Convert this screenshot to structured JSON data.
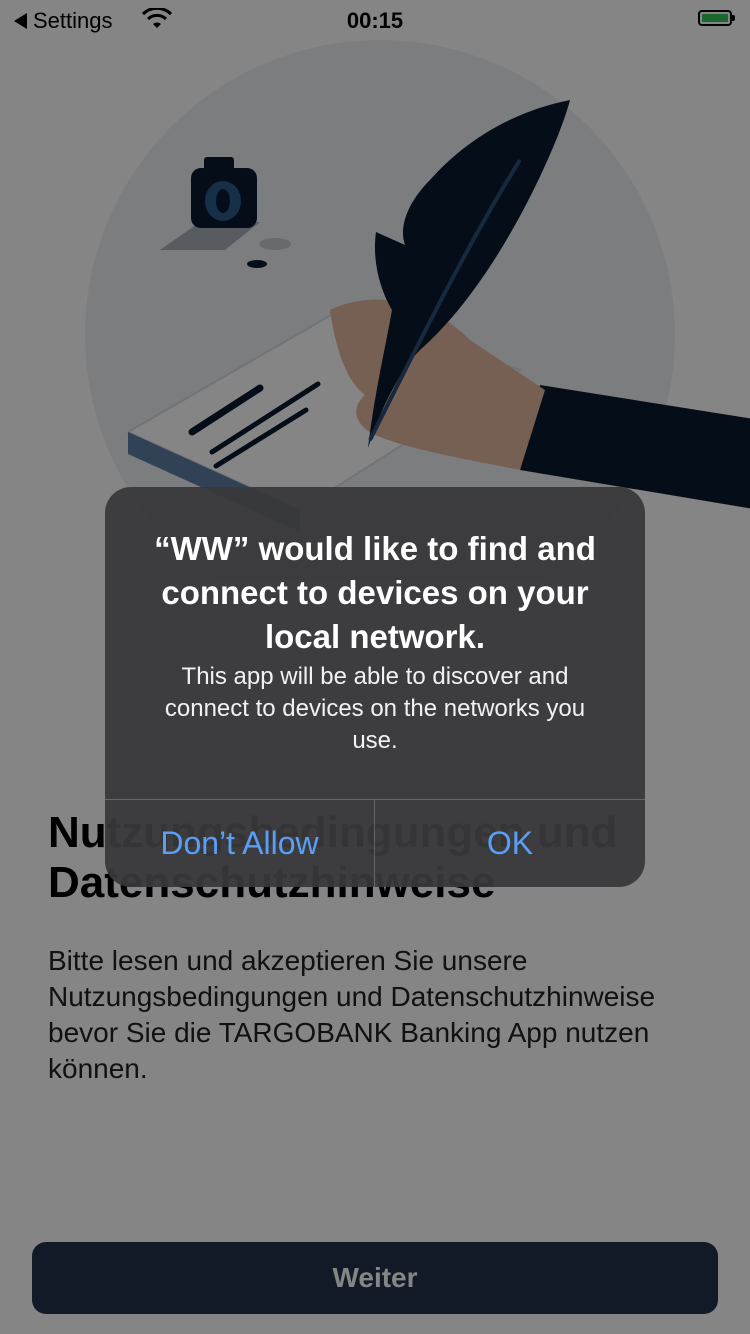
{
  "status_bar": {
    "back_label": "Settings",
    "time": "00:15"
  },
  "page": {
    "title": "Nutzungsbedingungen und Datenschutzhinweise",
    "body": "Bitte lesen und akzeptieren Sie unsere Nutzungsbedingungen und Datenschutzhinweise bevor Sie die TARGOBANK Banking App nutzen können.",
    "continue_label": "Weiter"
  },
  "alert": {
    "title": "“WW” would like to find and connect to devices on your local network.",
    "message": "This app will be able to discover and connect to devices on the networks you use.",
    "deny_label": "Don’t Allow",
    "allow_label": "OK"
  },
  "colors": {
    "alert_button": "#5a9ef5",
    "primary_button": "#21324a",
    "battery": "#34c759",
    "illustration_dark": "#0b1a2e"
  },
  "icons": [
    "back-arrow-icon",
    "wifi-icon",
    "battery-icon"
  ]
}
